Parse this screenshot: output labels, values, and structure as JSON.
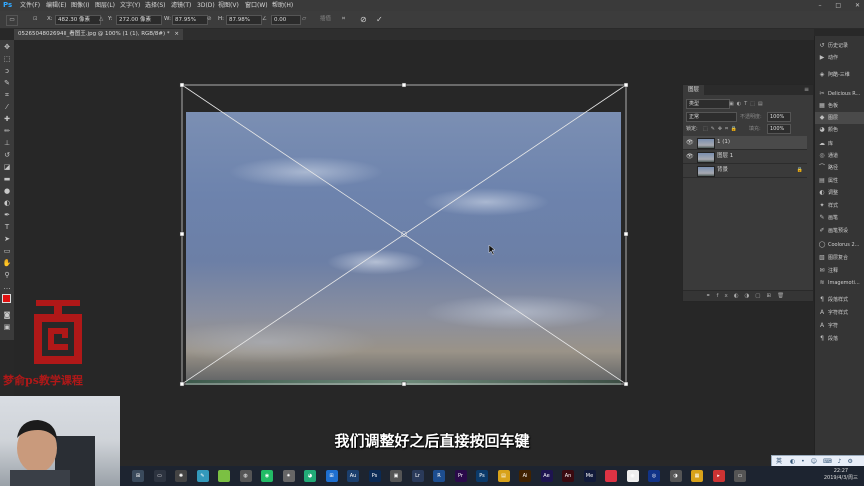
{
  "app": {
    "logo": "Ps"
  },
  "menu": [
    "文件(F)",
    "编辑(E)",
    "图像(I)",
    "图层(L)",
    "文字(Y)",
    "选择(S)",
    "滤镜(T)",
    "3D(D)",
    "视图(V)",
    "窗口(W)",
    "帮助(H)"
  ],
  "options_bar": {
    "x_label": "X:",
    "x_value": "482.30 像素",
    "y_label": "Y:",
    "y_value": "272.00 像素",
    "w_label": "W:",
    "w_value": "87.95%",
    "h_label": "H:",
    "h_value": "87.98%",
    "angle_value": "0.00",
    "interp_label": "插值",
    "cancel_icon": "cancel-icon",
    "commit_icon": "check-icon"
  },
  "document": {
    "tab_title": "0526504802694ll_看图王.jpg @ 100% (1 (1), RGB/8#) *"
  },
  "layers_panel": {
    "tab_label": "图层",
    "kind_placeholder": "类型",
    "blend_mode": "正常",
    "opacity_label": "不透明度:",
    "opacity_value": "100%",
    "lock_label": "锁定:",
    "fill_label": "填充:",
    "fill_value": "100%",
    "layers": [
      {
        "name": "1 (1)",
        "selected": true,
        "visible": true
      },
      {
        "name": "图层 1",
        "selected": false,
        "visible": true
      },
      {
        "name": "背景",
        "selected": false,
        "visible": false
      }
    ]
  },
  "right_panel": [
    {
      "label": "历史记录",
      "icon": "history-icon"
    },
    {
      "label": "动作",
      "icon": "play-icon"
    },
    {
      "label": "阿酷-三维",
      "icon": "plugin-icon"
    },
    {
      "label": "Delicious R...",
      "icon": "scissors-icon"
    },
    {
      "label": "色板",
      "icon": "swatches-icon"
    },
    {
      "label": "图层",
      "icon": "layers-icon"
    },
    {
      "label": "颜色",
      "icon": "color-icon"
    },
    {
      "label": "库",
      "icon": "library-icon"
    },
    {
      "label": "通道",
      "icon": "channels-icon"
    },
    {
      "label": "路径",
      "icon": "paths-icon"
    },
    {
      "label": "属性",
      "icon": "properties-icon"
    },
    {
      "label": "调整",
      "icon": "adjustments-icon"
    },
    {
      "label": "样式",
      "icon": "styles-icon"
    },
    {
      "label": "画笔",
      "icon": "brush-icon"
    },
    {
      "label": "画笔预设",
      "icon": "brush-presets-icon"
    },
    {
      "label": "Coolorus 2...",
      "icon": "color-wheel-icon"
    },
    {
      "label": "图层复合",
      "icon": "layer-comps-icon"
    },
    {
      "label": "注释",
      "icon": "notes-icon"
    },
    {
      "label": "Imagemoti...",
      "icon": "motion-icon"
    },
    {
      "label": "段落样式",
      "icon": "paragraph-styles-icon"
    },
    {
      "label": "字符样式",
      "icon": "character-styles-icon"
    },
    {
      "label": "字符",
      "icon": "character-icon"
    },
    {
      "label": "段落",
      "icon": "paragraph-icon"
    }
  ],
  "watermark": {
    "text": "梦俞ps教学课程"
  },
  "subtitle": "我们调整好之后直接按回车键",
  "taskbar": {
    "time": "22:27",
    "date": "2019/4/3/周三",
    "ime": "英"
  },
  "colors": {
    "accent": "#31a8ff",
    "watermark": "#b01818",
    "selection": "#4a4a4a"
  }
}
